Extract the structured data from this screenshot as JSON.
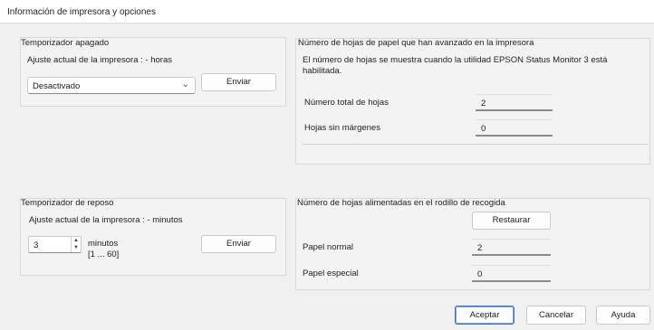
{
  "window": {
    "title": "Información de impresora y opciones"
  },
  "sleep_timer": {
    "title": "Temporizador apagado",
    "current_label": "Ajuste actual de la impresora : - horas",
    "select_value": "Desactivado",
    "send_label": "Enviar"
  },
  "sheets_fed": {
    "title": "Número de hojas de papel que han avanzado en la impresora",
    "note": "El número de hojas se muestra cuando la utilidad EPSON Status Monitor 3 está habilitada.",
    "rows": [
      {
        "label": "Número total de hojas",
        "value": "2"
      },
      {
        "label": "Hojas sin márgenes",
        "value": "0"
      }
    ]
  },
  "rest_timer": {
    "title": "Temporizador de reposo",
    "current_label": "Ajuste actual de la impresora : - minutos",
    "spin_value": "3",
    "unit_label": "minutos",
    "range_label": "[1 ... 60]",
    "send_label": "Enviar"
  },
  "pickup_roller": {
    "title": "Número de hojas alimentadas en el rodillo de recogida",
    "reset_label": "Restaurar",
    "rows": [
      {
        "label": "Papel normal",
        "value": "2"
      },
      {
        "label": "Papel especial",
        "value": "0"
      }
    ]
  },
  "footer": {
    "accept_label": "Aceptar",
    "cancel_label": "Cancelar",
    "help_label": "Ayuda"
  },
  "icons": {
    "dropdown": "chevron-down-icon",
    "spinner": "spin-arrows-icon"
  }
}
